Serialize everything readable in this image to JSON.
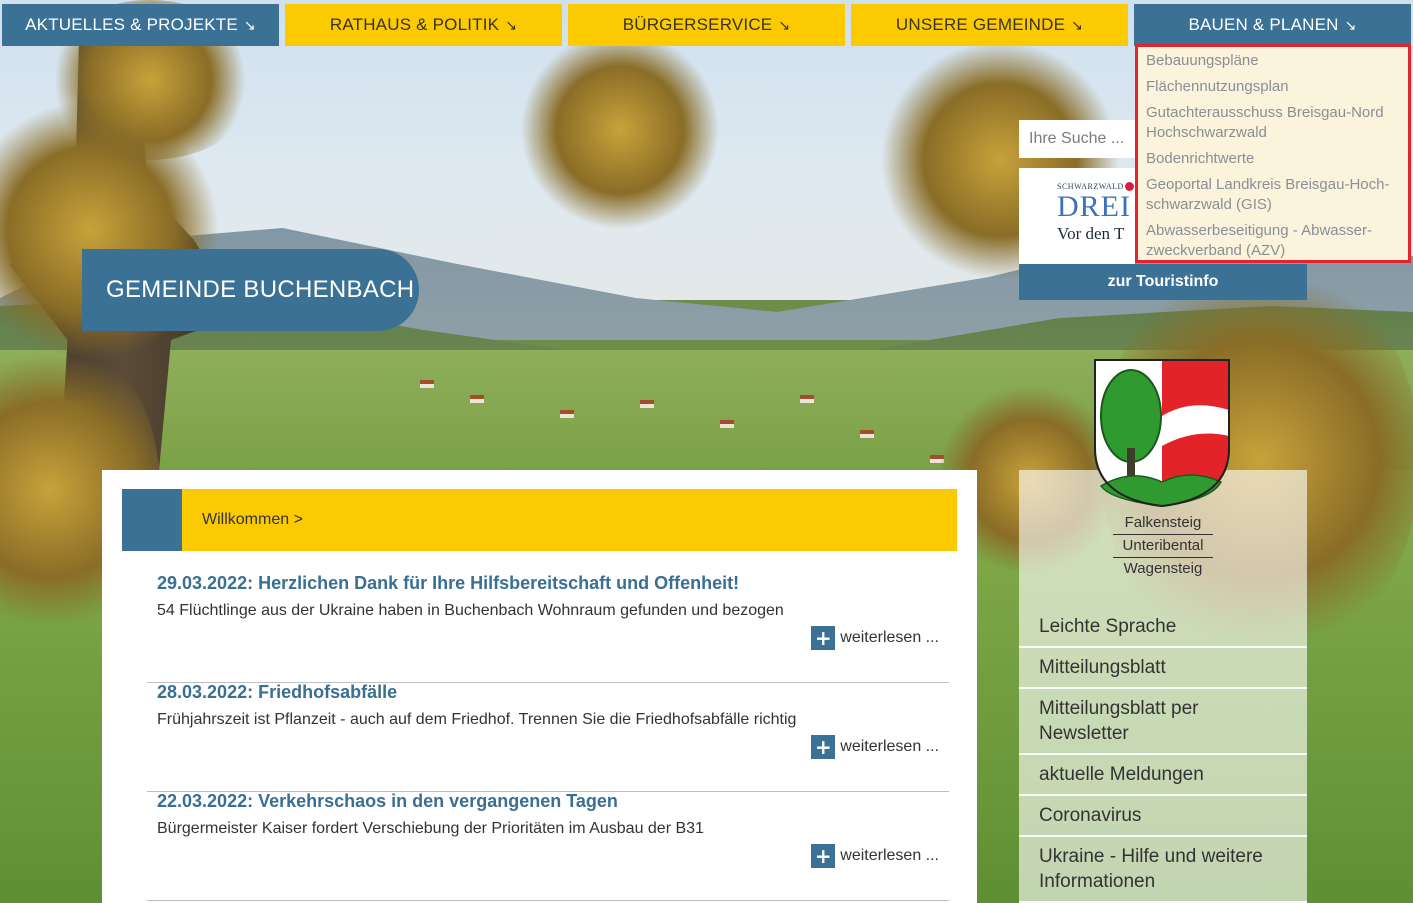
{
  "nav": [
    {
      "label": "AKTUELLES & PROJEKTE",
      "arrow": "↘"
    },
    {
      "label": "RATHAUS & POLITIK",
      "arrow": "↘"
    },
    {
      "label": "BÜRGERSERVICE",
      "arrow": "↘"
    },
    {
      "label": "UNSERE GEMEINDE",
      "arrow": "↘"
    },
    {
      "label": "BAUEN & PLANEN",
      "arrow": "↘"
    }
  ],
  "dropdown": {
    "items": [
      "Bebauungspläne",
      "Flächennutzungsplan",
      "Gutachterausschuss Breisgau-Nord Hochschwarzwald",
      "Bodenrichtwerte",
      "Geoportal Landkreis Breisgau-Hoch­schwarzwald (GIS)",
      "Abwasserbeseitigung - Abwasser­zweckverband (AZV)"
    ]
  },
  "search": {
    "placeholder": "Ihre Suche ..."
  },
  "banner": {
    "small": "SCHWARZWALD",
    "big": "DREI",
    "sub": "Vor den T"
  },
  "touristinfo": {
    "label": "zur Touristinfo"
  },
  "site_title": "GEMEINDE BUCHENBACH",
  "welcome": {
    "label": "Willkommen >"
  },
  "news": [
    {
      "title": "29.03.2022: Herzlichen Dank für Ihre Hilfsbereitschaft und Offenheit!",
      "text": "54 Flüchtlinge aus der Ukraine haben in Buchenbach Wohnraum gefunden und bezogen",
      "more": "weiterlesen ..."
    },
    {
      "title": "28.03.2022: Friedhofsabfälle",
      "text": "Frühjahrszeit ist Pflanzeit - auch auf dem Friedhof. Trennen Sie die Friedhofsabfälle richtig",
      "more": "weiterlesen ..."
    },
    {
      "title": "22.03.2022: Verkehrschaos in den vergangenen Tagen",
      "text": "Bürgermeister Kaiser fordert Verschiebung der Prioritäten im Ausbau der B31",
      "more": "weiterlesen ..."
    }
  ],
  "villages": [
    "Falkensteig",
    "Unteribental",
    "Wagensteig"
  ],
  "side_menu": [
    "Leichte Sprache",
    "Mitteilungsblatt",
    "Mitteilungsblatt per Newsletter",
    "aktuelle Meldungen",
    "Coronavirus",
    "Ukraine - Hilfe und weitere Informationen"
  ],
  "colors": {
    "primary_blue": "#3a7194",
    "accent_yellow": "#fcca00",
    "highlight_red": "#e0252c"
  }
}
